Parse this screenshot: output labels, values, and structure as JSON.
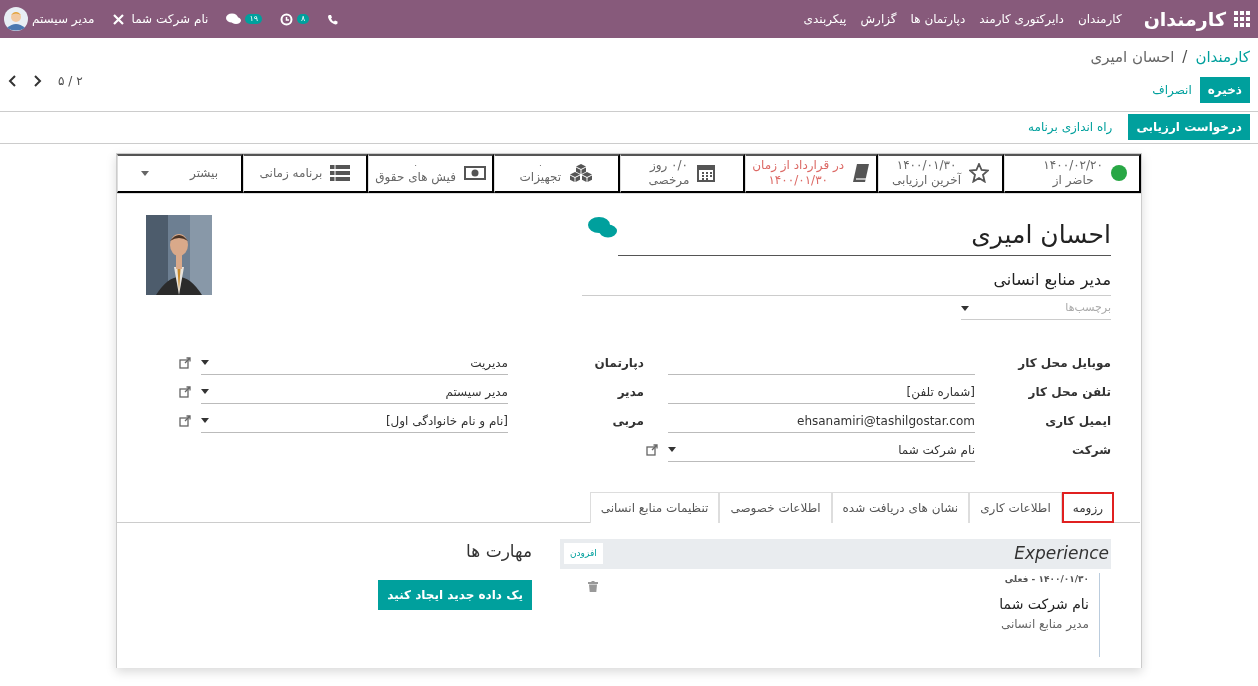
{
  "navbar": {
    "app_title": "کارمندان",
    "menu": [
      "کارمندان",
      "دایرکتوری کارمند",
      "دپارتمان ها",
      "گزارش",
      "پیکربندی"
    ],
    "activities_count": "۸",
    "messages_count": "۱۹",
    "company": "نام شرکت شما",
    "user": "مدیر سیستم"
  },
  "breadcrumb_separator": "/",
  "breadcrumb": [
    {
      "label": "کارمندان",
      "link": true
    },
    {
      "label": "احسان امیری",
      "link": false
    }
  ],
  "actions": {
    "save": "ذخیره",
    "discard": "انصراف"
  },
  "pager": "۲ / ۵",
  "header_buttons": [
    {
      "label": "درخواست ارزیابی",
      "primary": true
    },
    {
      "label": "راه اندازی برنامه",
      "primary": false
    }
  ],
  "smart_buttons": [
    {
      "kind": "presence",
      "lines": [
        "۱۴۰۰/۰۲/۲۰",
        "حاضر از"
      ],
      "warning": false
    },
    {
      "kind": "appraisal",
      "lines": [
        "۱۴۰۰/۰۱/۳۰",
        "آخرین ارزیابی"
      ],
      "warning": false
    },
    {
      "kind": "contract",
      "lines": [
        "در قرارداد از زمان",
        "۱۴۰۰/۰۱/۳۰"
      ],
      "warning": true
    },
    {
      "kind": "timeoff",
      "lines": [
        "۰/۰ روز",
        "مرخصی"
      ],
      "warning": false
    },
    {
      "kind": "equipment",
      "count": "۰",
      "lines": [
        "تجهیزات"
      ],
      "warning": false
    },
    {
      "kind": "payslips",
      "count": "۰",
      "lines": [
        "فیش های حقوق"
      ],
      "warning": false
    },
    {
      "kind": "planning",
      "lines": [
        "برنامه زمانی"
      ],
      "warning": false
    },
    {
      "kind": "more",
      "lines": [
        "بیشتر"
      ],
      "warning": false
    }
  ],
  "employee": {
    "name": "احسان امیری",
    "job_title": "مدیر منابع انسانی",
    "tags_placeholder": "برچسب‌ها"
  },
  "fields": [
    {
      "label": "موبایل محل کار",
      "kind": "text"
    },
    {
      "label": "دپارتمان",
      "kind": "select",
      "value": "مدیریت"
    },
    {
      "label": "تلفن محل کار",
      "kind": "text",
      "value": "[شماره تلفن]"
    },
    {
      "label": "مدیر",
      "kind": "select",
      "value": "مدیر سیستم"
    },
    {
      "label": "ایمیل کاری",
      "kind": "text",
      "value": "ehsanamiri@tashilgostar.com"
    },
    {
      "label": "مربی",
      "kind": "select",
      "value": "[نام و نام خانوادگی اول]"
    },
    {
      "label": "شرکت",
      "kind": "select",
      "value": "نام شرکت شما"
    }
  ],
  "tabs": [
    {
      "label": "رزومه",
      "selected": true,
      "highlighted": true
    },
    {
      "label": "اطلاعات کاری",
      "selected": false,
      "highlighted": false
    },
    {
      "label": "نشان های دریافت شده",
      "selected": false,
      "highlighted": false
    },
    {
      "label": "اطلاعات خصوصی",
      "selected": false,
      "highlighted": false
    },
    {
      "label": "تنظیمات منابع انسانی",
      "selected": false,
      "highlighted": false
    }
  ],
  "resume": {
    "section": "Experience",
    "add_button": "افزودن",
    "entries": [
      {
        "date": "۱۴۰۰/۰۱/۳۰ - فعلی",
        "title": "نام شرکت شما",
        "description": "مدیر منابع انسانی"
      }
    ]
  },
  "skills": {
    "title": "مهارت ها",
    "create_button": "یک داده جدید ایجاد کنید"
  }
}
